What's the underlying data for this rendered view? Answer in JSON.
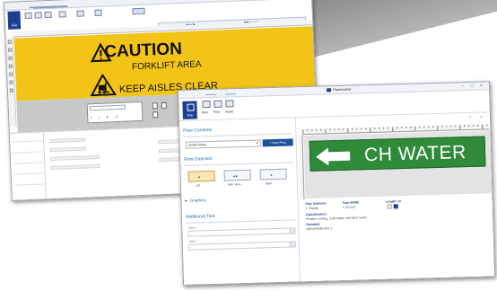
{
  "back_window": {
    "title": "CAUTION sign editor",
    "file_label": "File",
    "caution_heading": "CAUTION",
    "line1": "FORKLIFT AREA",
    "line2": "KEEP AISLES CLEAR",
    "sign_background_color": "#f2c417"
  },
  "front_window": {
    "title": "Pipemarker",
    "file_label": "File",
    "toolbar": [
      "New",
      "Print",
      "Styles"
    ],
    "left_panel": {
      "flow_contents_heading": "Flow Contents",
      "select_value": "Chilled Water",
      "new_button": "+ New Flow",
      "flow_direction_heading": "Flow Direction",
      "direction_labels": [
        "Left",
        "Both Sides",
        "Right"
      ],
      "graphics_label": "Graphics",
      "additional_text_heading": "Additional Text",
      "line1_label": "Line 1",
      "line2_label": "Line 2"
    },
    "marker": {
      "text": "CH WATER",
      "color": "#2f8a3a",
      "arrow": "left-arrow-icon"
    },
    "properties": {
      "pipe_diameter_label": "Pipe Diameter",
      "pipe_diameter_value": "1\" Range",
      "tape_width_label": "Tape Width",
      "tape_width_value": "1.25 inch",
      "length_label": "Length / In",
      "classification_label": "Classification",
      "classification_value": "Potable cooling, Cold water and other water",
      "standard_label": "Standard",
      "standard_value": "ANSI/ASME A13.1"
    }
  }
}
